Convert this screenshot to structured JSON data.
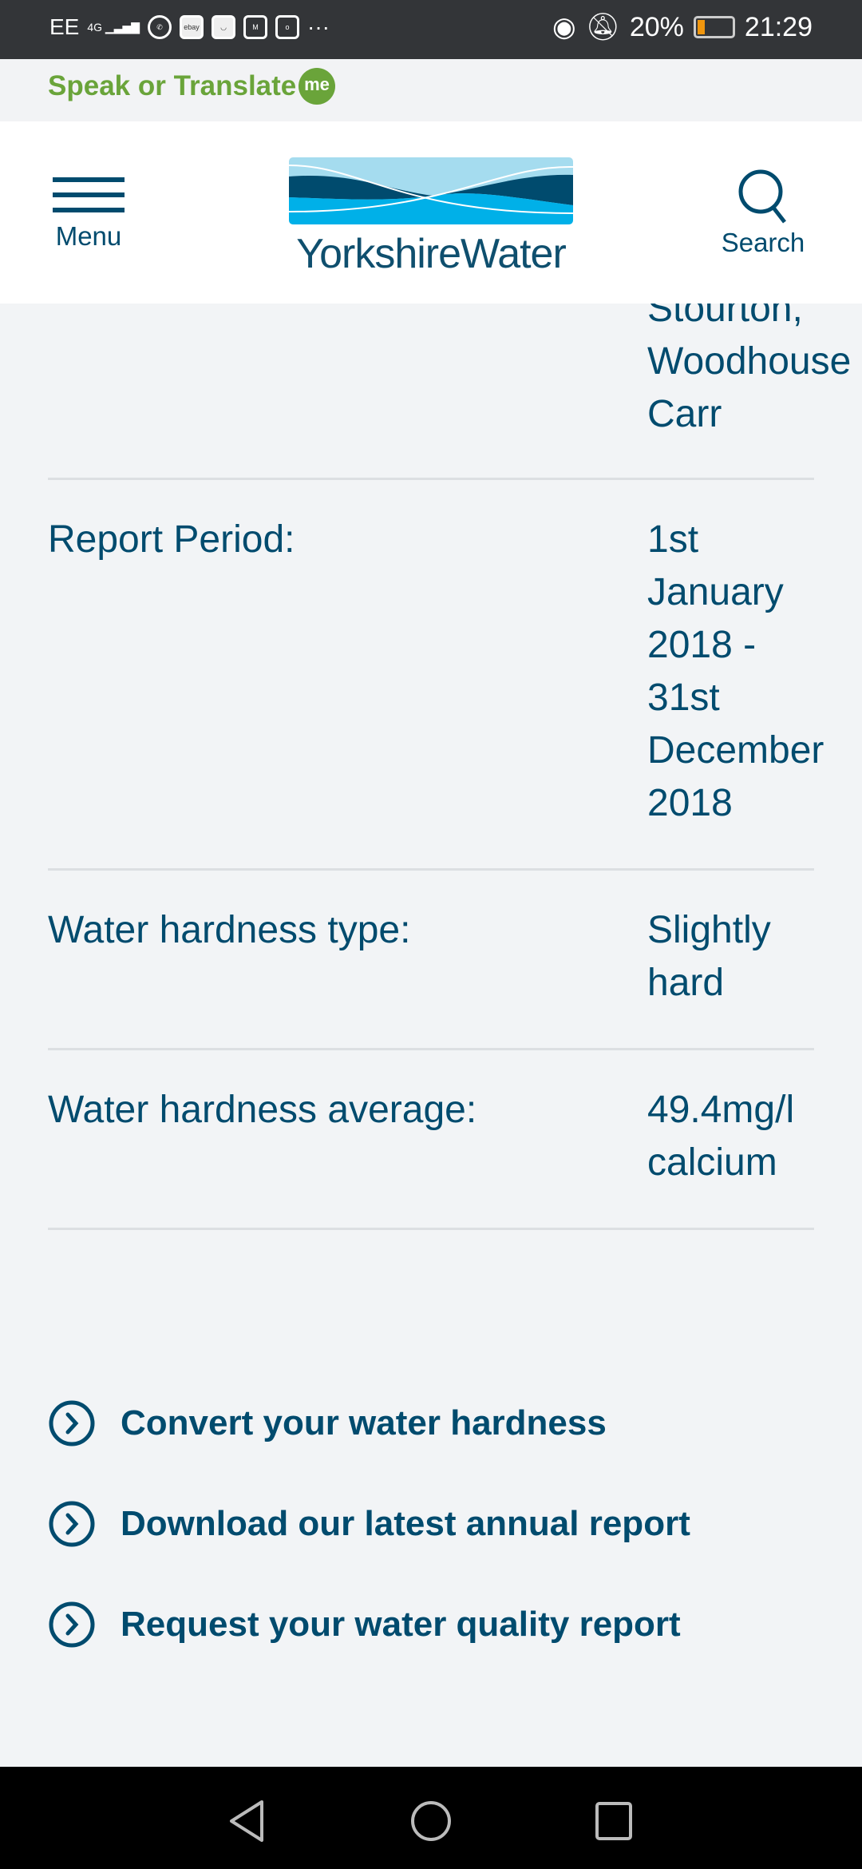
{
  "status_bar": {
    "carrier": "EE",
    "network": "4G",
    "battery": "20%",
    "battery_level": 0.2,
    "time": "21:29",
    "more": "···",
    "app_icons": [
      "whatsapp-icon",
      "ebay-icon",
      "huawei-icon",
      "gmail-icon",
      "outlook-icon"
    ],
    "colors": {
      "battery": "#f0960e"
    }
  },
  "speak_bar": {
    "label": "Speak or Translate",
    "badge": "me",
    "color": "#6aa43a"
  },
  "header": {
    "menu_label": "Menu",
    "logo_text": "YorkshireWater",
    "search_label": "Search"
  },
  "details": [
    {
      "label": "",
      "value": "Stourton,\nWoodhouse\nCarr"
    },
    {
      "label": "Report Period:",
      "value": "1st\nJanuary\n2018 -\n31st\nDecember\n2018"
    },
    {
      "label": "Water hardness type:",
      "value": "Slightly\nhard"
    },
    {
      "label": "Water hardness average:",
      "value": "49.4mg/l\ncalcium"
    }
  ],
  "links": [
    {
      "label": "Convert your water hardness"
    },
    {
      "label": "Download our latest annual report"
    },
    {
      "label": "Request your water quality report"
    }
  ],
  "colors": {
    "text": "#004b6e",
    "background": "#f2f4f6"
  }
}
